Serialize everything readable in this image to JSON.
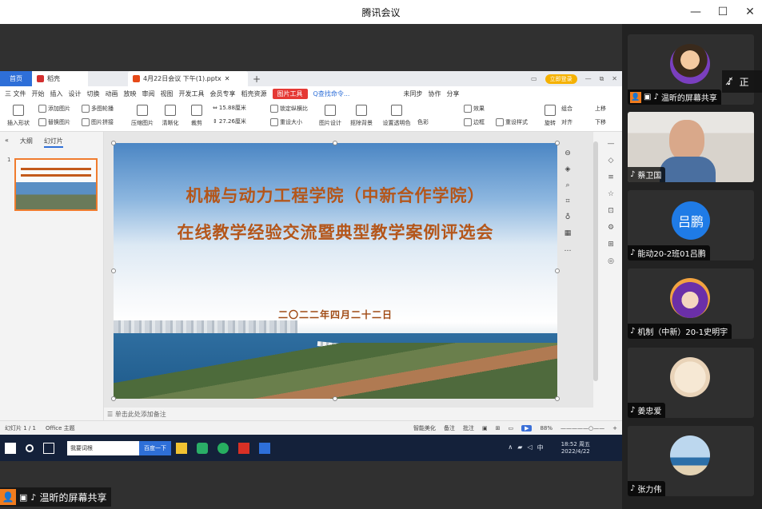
{
  "window": {
    "title": "腾讯会议",
    "minimize": "—",
    "maximize": "☐",
    "close": "✕"
  },
  "wps": {
    "tabs": {
      "home": "首页",
      "wps": "稻壳",
      "document": "4月22日会议 下午(1).pptx",
      "login": "立即登录"
    },
    "menu": [
      "三 文件",
      "开始",
      "插入",
      "设计",
      "切换",
      "动画",
      "放映",
      "审阅",
      "视图",
      "开发工具",
      "会员专享",
      "稻壳资源"
    ],
    "menu_active": "图片工具",
    "menu_search": "Q查找命令...",
    "menu_right": [
      "未同步",
      "协作",
      "分享"
    ],
    "ribbon": {
      "insert_shape": "插入形状",
      "add_image": "添加图片",
      "replace_image": "替换图片",
      "multi_image": "多图轮播",
      "image_adjust": "图片拼接",
      "crop_image": "压缩图片",
      "clear_image": "清晰化",
      "crop": "裁剪",
      "width": "15.88厘米",
      "height": "27.26厘米",
      "lock_ratio": "锁定纵横比",
      "reset_size": "重设大小",
      "image_design": "图片设计",
      "remove_bg": "抠除背景",
      "set_transparent": "设置透明色",
      "color": "色彩",
      "effects": "效果",
      "border": "边框",
      "reset_style": "重设样式",
      "rotate": "旋转",
      "group": "组合",
      "align": "对齐",
      "move_up": "上移",
      "move_down": "下移",
      "selection_pane": "选择窗格"
    },
    "left_panel": {
      "tab_outline": "大纲",
      "tab_slides": "幻灯片",
      "slide_number": "1",
      "add": "+"
    },
    "slide": {
      "title_line1": "机械与动力工程学院（中新合作学院）",
      "title_line2": "在线教学经验交流暨典型教学案例评选会",
      "date": "二〇二二年四月二十二日"
    },
    "notes_placeholder": "单击此处添加备注",
    "status": {
      "slide_count": "幻灯片 1 / 1",
      "theme": "Office 主题",
      "smart_beautify": "智能美化",
      "notes": "备注",
      "comments": "批注",
      "zoom": "88%"
    }
  },
  "taskbar": {
    "search_text": "我要词根",
    "baidu": "百度一下",
    "time": "18:52 周五",
    "date": "2022/4/22",
    "ime": "中"
  },
  "share_badge": "温昕的屏幕共享",
  "mic_off_label": "正",
  "participants": [
    {
      "name": "温昕的屏幕共享",
      "kind": "photo-avatar"
    },
    {
      "name": "蔡卫国",
      "kind": "video"
    },
    {
      "name": "能动20-2班01吕鹏",
      "kind": "text-avatar",
      "initials": "吕鹏",
      "color": "#1f7be6"
    },
    {
      "name": "机制（中新）20-1史明宇",
      "kind": "cartoon-avatar"
    },
    {
      "name": "姜忠爱",
      "kind": "cute-avatar"
    },
    {
      "name": "张力伟",
      "kind": "sea-avatar"
    }
  ]
}
